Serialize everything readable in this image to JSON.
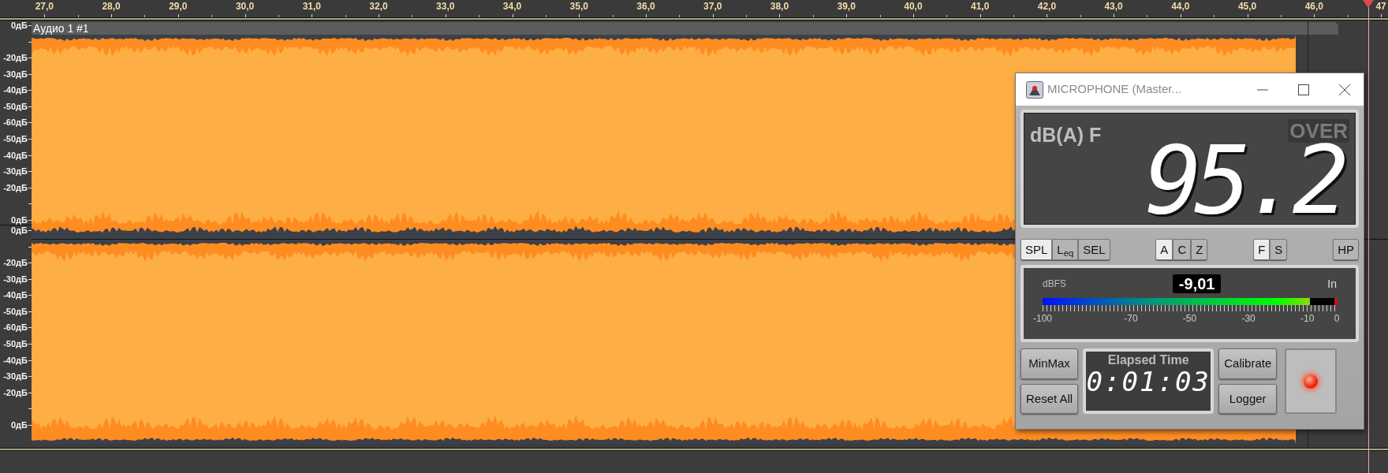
{
  "ruler": {
    "labels": [
      "27,0",
      "28,0",
      "29,0",
      "30,0",
      "31,0",
      "32,0",
      "33,0",
      "34,0",
      "35,0",
      "36,0",
      "37,0",
      "38,0",
      "39,0",
      "40,0",
      "41,0",
      "42,0",
      "43,0",
      "44,0",
      "45,0",
      "46,0",
      "47"
    ]
  },
  "track": {
    "title": "Аудио 1 #1",
    "channels": [
      {
        "scale": [
          {
            "kind": "label",
            "text": "0дБ"
          },
          {
            "kind": "tick"
          },
          {
            "kind": "label",
            "text": "-20дБ"
          },
          {
            "kind": "label",
            "text": "-30дБ"
          },
          {
            "kind": "label",
            "text": "-40дБ"
          },
          {
            "kind": "label",
            "text": "-50дБ"
          },
          {
            "kind": "label",
            "text": "-60дБ"
          },
          {
            "kind": "label",
            "text": "-50дБ"
          },
          {
            "kind": "label",
            "text": "-40дБ"
          },
          {
            "kind": "label",
            "text": "-30дБ"
          },
          {
            "kind": "label",
            "text": "-20дБ"
          },
          {
            "kind": "tick"
          },
          {
            "kind": "label",
            "text": "0дБ"
          }
        ]
      },
      {
        "scale": [
          {
            "kind": "label",
            "text": "0дБ"
          },
          {
            "kind": "tick"
          },
          {
            "kind": "label",
            "text": "-20дБ"
          },
          {
            "kind": "label",
            "text": "-30дБ"
          },
          {
            "kind": "label",
            "text": "-40дБ"
          },
          {
            "kind": "label",
            "text": "-50дБ"
          },
          {
            "kind": "label",
            "text": "-60дБ"
          },
          {
            "kind": "label",
            "text": "-50дБ"
          },
          {
            "kind": "label",
            "text": "-40дБ"
          },
          {
            "kind": "label",
            "text": "-30дБ"
          },
          {
            "kind": "label",
            "text": "-20дБ"
          },
          {
            "kind": "tick"
          },
          {
            "kind": "label",
            "text": "0дБ"
          }
        ]
      }
    ]
  },
  "meter_window": {
    "title": "MICROPHONE (Master...",
    "display": {
      "weighting": "dB(A) F",
      "over": {
        "label": "OVER",
        "on": false
      },
      "reading": "95.2"
    },
    "button_groups": [
      [
        {
          "label": "SPL",
          "selected": true
        },
        {
          "label": "L$_{eq}$",
          "selected": false
        },
        {
          "label": "SEL",
          "selected": false
        }
      ],
      [
        {
          "label": "A",
          "selected": true
        },
        {
          "label": "C",
          "selected": false
        },
        {
          "label": "Z",
          "selected": false
        }
      ],
      [
        {
          "label": "F",
          "selected": true
        },
        {
          "label": "S",
          "selected": false
        }
      ],
      [
        {
          "label": "HP",
          "selected": false
        }
      ]
    ],
    "level_meter": {
      "unit": "dBFS",
      "value": "-9,01",
      "input": "In",
      "level": 0.91,
      "clip": true,
      "scale": [
        "-100",
        "-70",
        "-50",
        "-30",
        "-10",
        "0"
      ]
    },
    "left_buttons": [
      "MinMax",
      "Reset All"
    ],
    "elapsed": {
      "label": "Elapsed Time",
      "value": "0:01:03"
    },
    "right_buttons": [
      "Calibrate",
      "Logger"
    ],
    "recording": true
  }
}
